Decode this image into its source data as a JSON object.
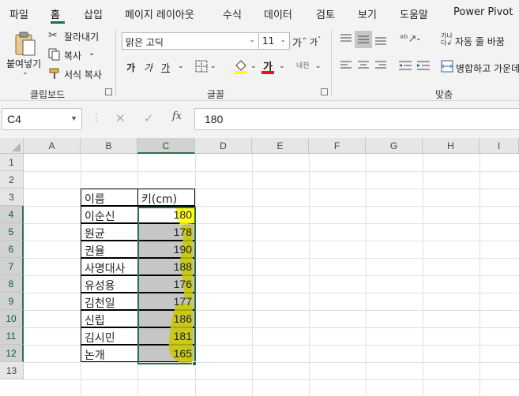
{
  "tabs": [
    "파일",
    "홈",
    "삽입",
    "페이지 레이아웃",
    "수식",
    "데이터",
    "검토",
    "보기",
    "도움말",
    "Power Pivot"
  ],
  "ribbon": {
    "clipboard": {
      "paste": "붙여넣기",
      "cut": "잘라내기",
      "copy": "복사",
      "format_painter": "서식 복사",
      "label": "클립보드"
    },
    "font": {
      "name": "맑은 고딕",
      "size": "11",
      "bold": "가",
      "italic": "가",
      "underline": "가",
      "label": "글꼴",
      "font_color": "가",
      "phonetic": "내천"
    },
    "alignment": {
      "wrap_text": "자동 줄 바꿈",
      "merge_center": "병합하고 가운데",
      "label": "맞춤"
    }
  },
  "formula_bar": {
    "name_box": "C4",
    "fx": "fx",
    "formula": "180"
  },
  "columns": [
    "A",
    "B",
    "C",
    "D",
    "E",
    "F",
    "G",
    "H",
    "I"
  ],
  "rows": [
    "1",
    "2",
    "3",
    "4",
    "5",
    "6",
    "7",
    "8",
    "9",
    "10",
    "11",
    "12",
    "13"
  ],
  "table": {
    "header_name": "이름",
    "header_height": "키(cm)",
    "rows": [
      {
        "name": "이순신",
        "height": "180"
      },
      {
        "name": "원균",
        "height": "178"
      },
      {
        "name": "권율",
        "height": "190"
      },
      {
        "name": "사명대사",
        "height": "188"
      },
      {
        "name": "유성용",
        "height": "176"
      },
      {
        "name": "김천일",
        "height": "177"
      },
      {
        "name": "신립",
        "height": "186"
      },
      {
        "name": "김시민",
        "height": "181"
      },
      {
        "name": "논개",
        "height": "165"
      }
    ]
  },
  "colors": {
    "accent": "#217346",
    "highlight": "#c8c800",
    "selection": "#c6c6c6"
  }
}
